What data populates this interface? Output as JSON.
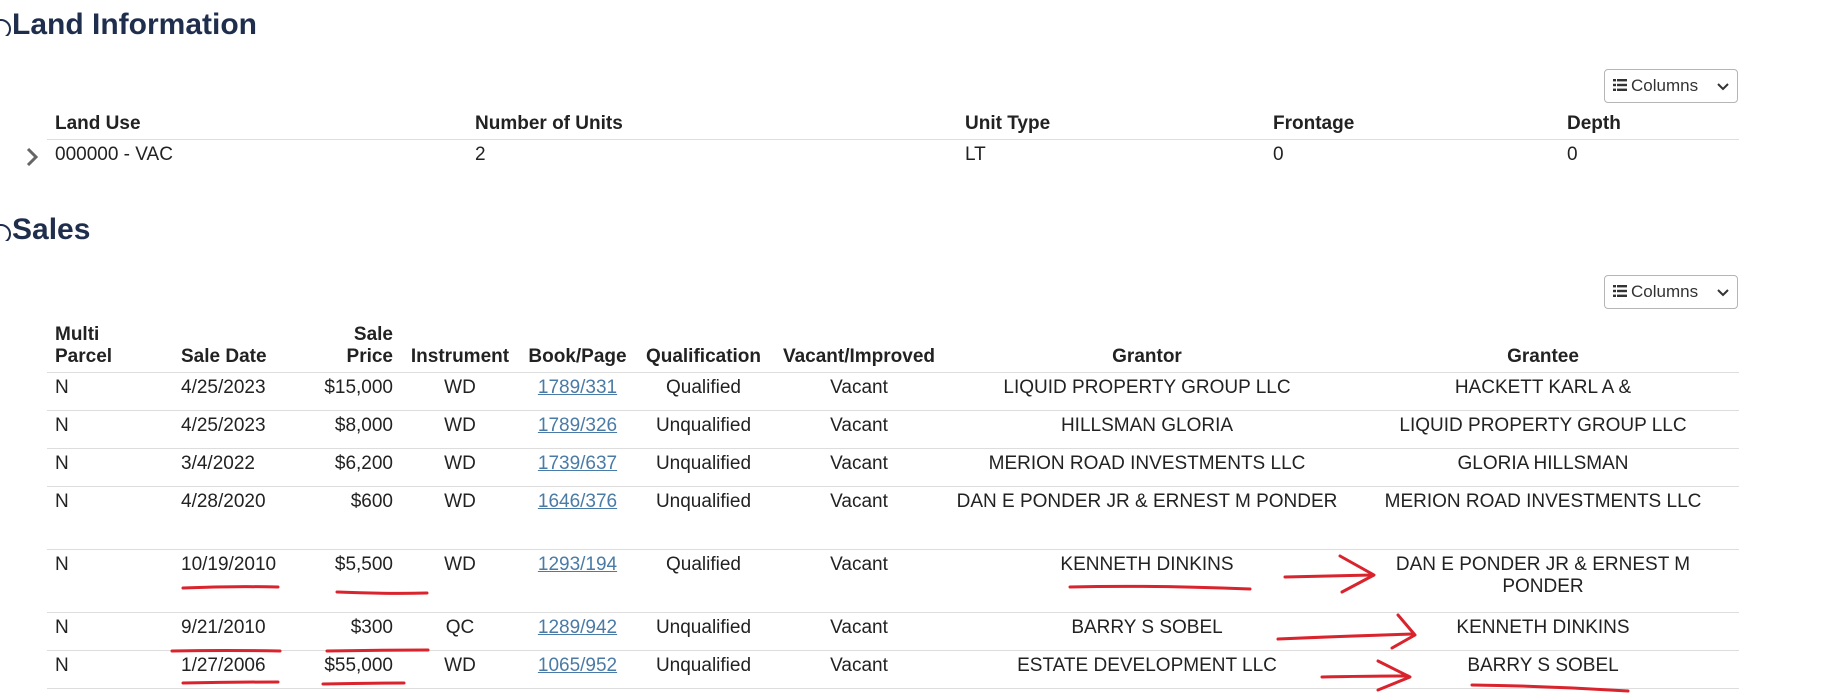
{
  "land_section": {
    "title": "Land Information",
    "columns_button": "Columns",
    "headers": [
      "Land Use",
      "Number of Units",
      "Unit Type",
      "Frontage",
      "Depth"
    ],
    "rows": [
      {
        "land_use": "000000 - VAC",
        "units": "2",
        "unit_type": "LT",
        "frontage": "0",
        "depth": "0"
      }
    ]
  },
  "sales_section": {
    "title": "Sales",
    "columns_button": "Columns",
    "headers": {
      "multi_parcel_1": "Multi",
      "multi_parcel_2": "Parcel",
      "sale_date": "Sale Date",
      "sale_price_1": "Sale",
      "sale_price_2": "Price",
      "instrument": "Instrument",
      "book_page": "Book/Page",
      "qualification": "Qualification",
      "vacant_improved": "Vacant/Improved",
      "grantor": "Grantor",
      "grantee": "Grantee"
    },
    "rows": [
      {
        "multi": "N",
        "date": "4/25/2023",
        "price": "$15,000",
        "instrument": "WD",
        "book": "1789/331",
        "qual": "Qualified",
        "vacant": "Vacant",
        "grantor": "LIQUID PROPERTY GROUP LLC",
        "grantee": "HACKETT KARL A &"
      },
      {
        "multi": "N",
        "date": "4/25/2023",
        "price": "$8,000",
        "instrument": "WD",
        "book": "1789/326",
        "qual": "Unqualified",
        "vacant": "Vacant",
        "grantor": "HILLSMAN GLORIA",
        "grantee": "LIQUID PROPERTY GROUP LLC"
      },
      {
        "multi": "N",
        "date": "3/4/2022",
        "price": "$6,200",
        "instrument": "WD",
        "book": "1739/637",
        "qual": "Unqualified",
        "vacant": "Vacant",
        "grantor": "MERION ROAD INVESTMENTS LLC",
        "grantee": "GLORIA HILLSMAN"
      },
      {
        "multi": "N",
        "date": "4/28/2020",
        "price": "$600",
        "instrument": "WD",
        "book": "1646/376",
        "qual": "Unqualified",
        "vacant": "Vacant",
        "grantor": "DAN E PONDER JR & ERNEST M PONDER",
        "grantee": "MERION ROAD INVESTMENTS LLC"
      },
      {
        "multi": "N",
        "date": "10/19/2010",
        "price": "$5,500",
        "instrument": "WD",
        "book": "1293/194",
        "qual": "Qualified",
        "vacant": "Vacant",
        "grantor": "KENNETH DINKINS",
        "grantee": "DAN E PONDER JR & ERNEST M PONDER"
      },
      {
        "multi": "N",
        "date": "9/21/2010",
        "price": "$300",
        "instrument": "QC",
        "book": "1289/942",
        "qual": "Unqualified",
        "vacant": "Vacant",
        "grantor": "BARRY S SOBEL",
        "grantee": "KENNETH DINKINS"
      },
      {
        "multi": "N",
        "date": "1/27/2006",
        "price": "$55,000",
        "instrument": "WD",
        "book": "1065/952",
        "qual": "Unqualified",
        "vacant": "Vacant",
        "grantor": "ESTATE DEVELOPMENT LLC",
        "grantee": "BARRY S SOBEL"
      }
    ]
  },
  "colors": {
    "heading": "#1f2e4d",
    "link": "#4a7ba6",
    "annotation": "#d9232d"
  }
}
